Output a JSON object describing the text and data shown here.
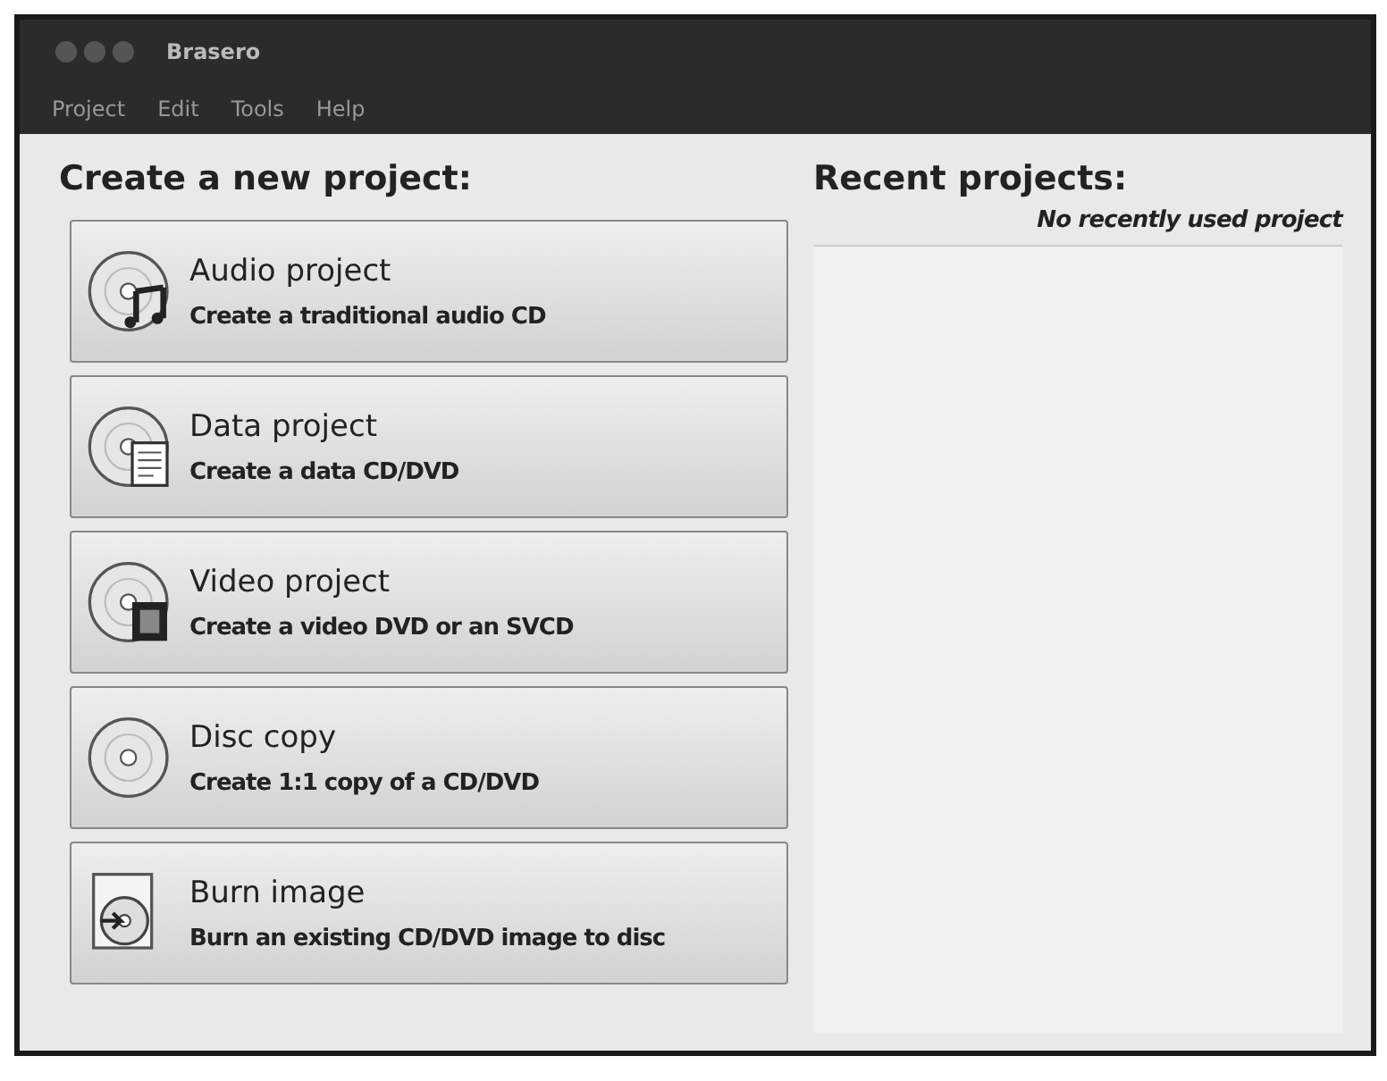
{
  "window": {
    "title": "Brasero"
  },
  "menu": [
    "Project",
    "Edit",
    "Tools",
    "Help"
  ],
  "create": {
    "heading": "Create a new project:",
    "projects": [
      {
        "kind": "audio",
        "title": "Audio project",
        "description": "Create a traditional audio CD"
      },
      {
        "kind": "data",
        "title": "Data project",
        "description": "Create a data CD/DVD"
      },
      {
        "kind": "video",
        "title": "Video project",
        "description": "Create a video DVD or an SVCD"
      },
      {
        "kind": "copy",
        "title": "Disc copy",
        "description": "Create 1:1 copy of a CD/DVD"
      },
      {
        "kind": "image",
        "title": "Burn image",
        "description": "Burn an existing CD/DVD image to disc"
      }
    ]
  },
  "recent": {
    "heading": "Recent projects:",
    "empty_message": "No recently used project"
  }
}
